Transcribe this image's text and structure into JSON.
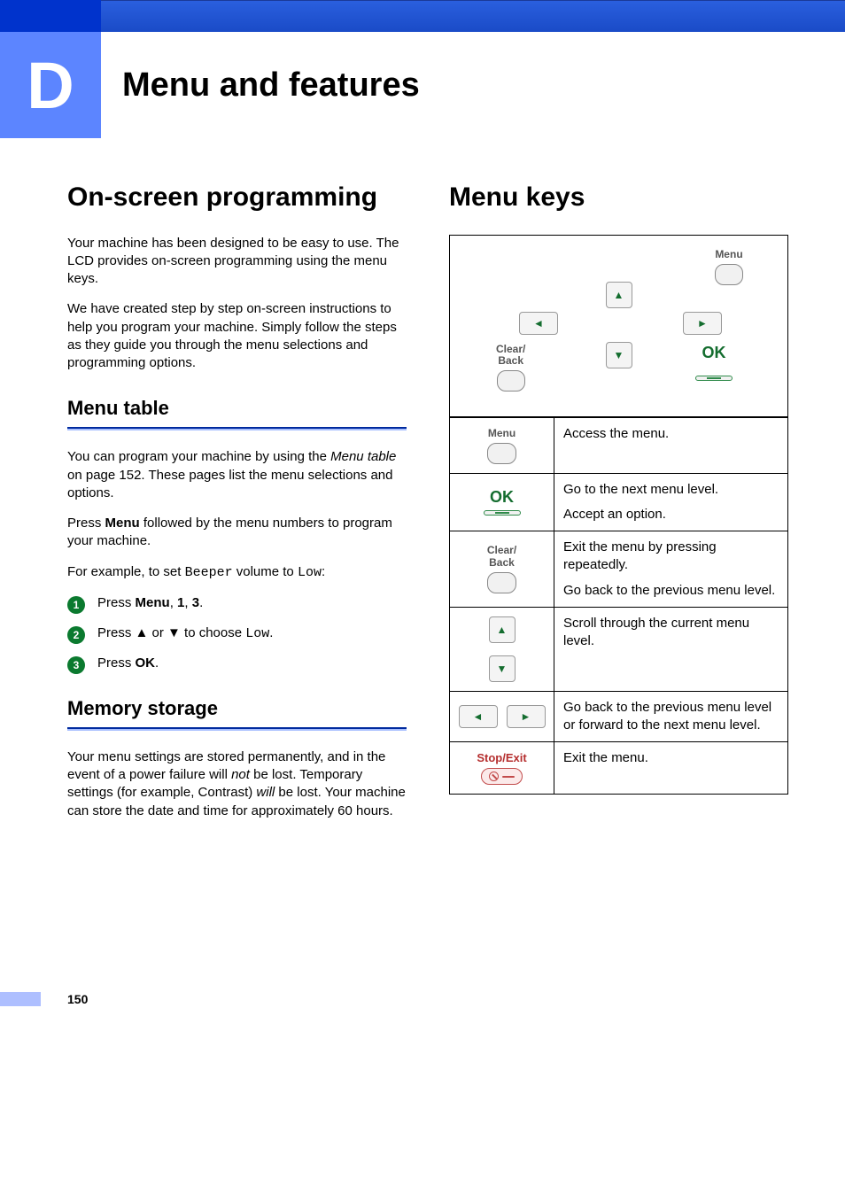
{
  "chapter": {
    "letter": "D",
    "title": "Menu and features"
  },
  "left": {
    "h1": "On-screen programming",
    "p1": "Your machine has been designed to be easy to use. The LCD provides on-screen programming using the menu keys.",
    "p2": "We have created step by step on-screen instructions to help you program your machine. Simply follow the steps as they guide you through the menu selections and programming options.",
    "menu_table_h": "Menu table",
    "mt_p1_a": "You can program your machine by using the ",
    "mt_p1_italic": "Menu table",
    "mt_p1_b": " on page 152. These pages list the menu selections and options.",
    "mt_p2_a": "Press ",
    "mt_p2_bold": "Menu",
    "mt_p2_b": " followed by the menu numbers to program your machine.",
    "mt_p3_a": "For example, to set ",
    "mt_p3_mono1": "Beeper",
    "mt_p3_b": " volume to ",
    "mt_p3_mono2": "Low",
    "mt_p3_c": ":",
    "step1_a": "Press ",
    "step1_bold": "Menu",
    "step1_b": ", ",
    "step1_c": "1",
    "step1_d": ", ",
    "step1_e": "3",
    "step1_f": ".",
    "step2_a": "Press ▲ or ▼ to choose ",
    "step2_mono": "Low",
    "step2_b": ".",
    "step3_a": "Press ",
    "step3_bold": "OK",
    "step3_b": ".",
    "memory_h": "Memory storage",
    "mem_a": "Your menu settings are stored permanently, and in the event of a power failure will ",
    "mem_not": "not",
    "mem_b": " be lost. Temporary settings (for example, Contrast) ",
    "mem_will": "will",
    "mem_c": " be lost. Your machine can store the date and time for approximately 60 hours."
  },
  "right": {
    "h1": "Menu keys",
    "labels": {
      "menu": "Menu",
      "ok": "OK",
      "clear": "Clear/",
      "back": "Back",
      "stop": "Stop/Exit"
    },
    "rows": [
      {
        "desc": [
          "Access the menu."
        ]
      },
      {
        "desc": [
          "Go to the next menu level.",
          "Accept an option."
        ]
      },
      {
        "desc": [
          "Exit the menu by pressing repeatedly.",
          "Go back to the previous menu level."
        ]
      },
      {
        "desc": [
          "Scroll through the current menu level."
        ]
      },
      {
        "desc": [
          "Go back to the previous menu level or forward to the next menu level."
        ]
      },
      {
        "desc": [
          "Exit the menu."
        ]
      }
    ]
  },
  "page_number": "150"
}
